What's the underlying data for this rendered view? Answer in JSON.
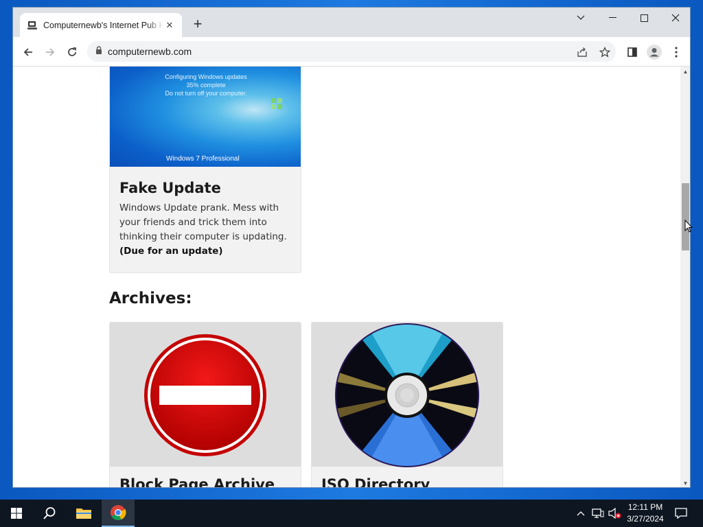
{
  "browser": {
    "tab_title": "Computernewb's Internet Pub Hub",
    "url": "computernewb.com",
    "window_controls": [
      "chevron-down-icon",
      "minimize-icon",
      "maximize-icon",
      "close-icon"
    ]
  },
  "page": {
    "fake_update": {
      "screen_lines": [
        "Configuring Windows updates",
        "35% complete",
        "Do not turn off your computer."
      ],
      "screen_brand": "Windows 7 Professional",
      "title": "Fake Update",
      "description": "Windows Update prank. Mess with your friends and trick them into thinking their computer is updating.",
      "note": "(Due for an update)"
    },
    "archives_heading": "Archives:",
    "archive_cards": [
      {
        "title": "Block Page Archive",
        "image": "no-entry-sign-icon"
      },
      {
        "title": "ISO Directory",
        "image": "cd-disc-icon"
      }
    ]
  },
  "taskbar": {
    "time": "12:11 PM",
    "date": "3/27/2024",
    "pinned": [
      "windows-start-icon",
      "search-icon",
      "file-explorer-icon",
      "chrome-icon"
    ]
  },
  "colors": {
    "sign_red": "#d80000",
    "taskbar": "#0e1621",
    "desktop": "#0a58c0"
  }
}
